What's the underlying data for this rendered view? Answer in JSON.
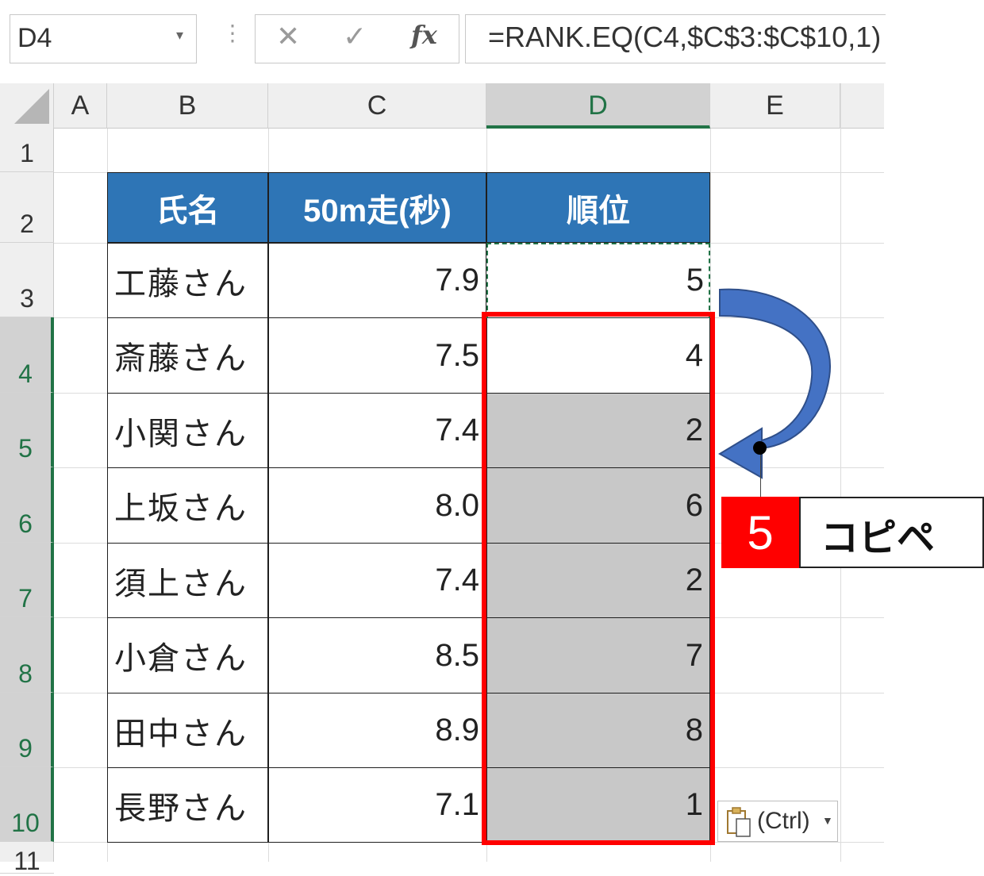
{
  "formula_bar": {
    "name_box": "D4",
    "formula": "=RANK.EQ(C4,$C$3:$C$10,1)",
    "fx_label": "fx"
  },
  "columns": [
    "A",
    "B",
    "C",
    "D",
    "E"
  ],
  "rows": [
    "1",
    "2",
    "3",
    "4",
    "5",
    "6",
    "7",
    "8",
    "9",
    "10",
    "11"
  ],
  "table": {
    "headers": [
      "氏名",
      "50m走(秒)",
      "順位"
    ],
    "rows": [
      {
        "name": "工藤さん",
        "time": "7.9",
        "rank": "5"
      },
      {
        "name": "斎藤さん",
        "time": "7.5",
        "rank": "4"
      },
      {
        "name": "小関さん",
        "time": "7.4",
        "rank": "2"
      },
      {
        "name": "上坂さん",
        "time": "8.0",
        "rank": "6"
      },
      {
        "name": "須上さん",
        "time": "7.4",
        "rank": "2"
      },
      {
        "name": "小倉さん",
        "time": "8.5",
        "rank": "7"
      },
      {
        "name": "田中さん",
        "time": "8.9",
        "rank": "8"
      },
      {
        "name": "長野さん",
        "time": "7.1",
        "rank": "1"
      }
    ]
  },
  "callout": {
    "step_number": "5",
    "label": "コピペ"
  },
  "paste_options": {
    "label": "(Ctrl)"
  },
  "colors": {
    "header_fill": "#2e75b6",
    "selection_green": "#217346",
    "highlight_red": "#ff0000",
    "arrow_blue": "#4472c4"
  }
}
